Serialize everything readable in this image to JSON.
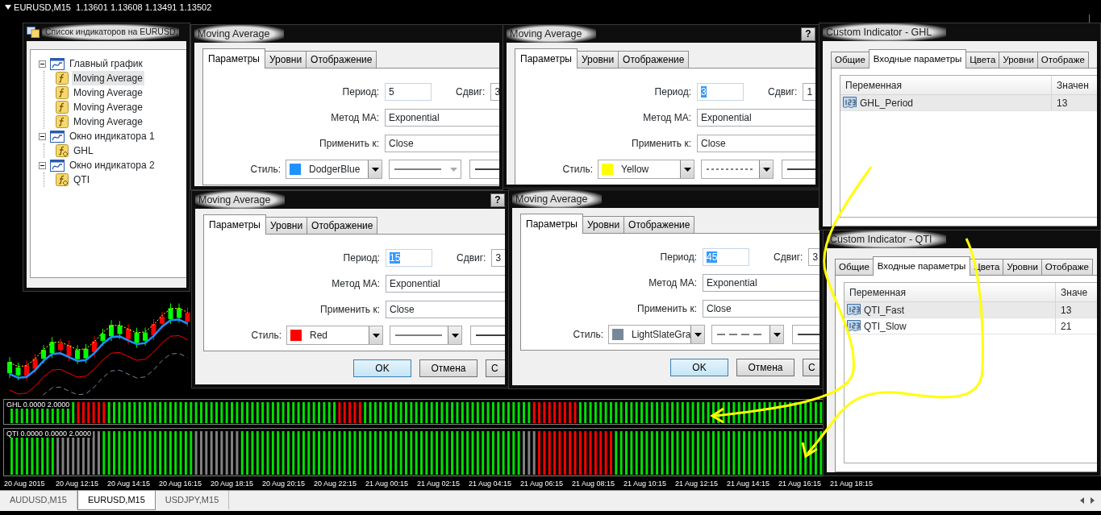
{
  "chart": {
    "header": "EURUSD,M15  1.13601 1.13608 1.13491 1.13502"
  },
  "indicator_windows": [
    {
      "label": "GHL 0.0000 2.0000"
    },
    {
      "label": "QTI 0.0000 0.0000 2.0000"
    }
  ],
  "time_axis": [
    "20 Aug 2015",
    "20 Aug 12:15",
    "20 Aug 14:15",
    "20 Aug 16:15",
    "20 Aug 18:15",
    "20 Aug 20:15",
    "20 Aug 22:15",
    "21 Aug 00:15",
    "21 Aug 02:15",
    "21 Aug 04:15",
    "21 Aug 06:15",
    "21 Aug 08:15",
    "21 Aug 10:15",
    "21 Aug 12:15",
    "21 Aug 14:15",
    "21 Aug 16:15",
    "21 Aug 18:15"
  ],
  "symbol_tabs": [
    {
      "label": "AUDUSD,M15",
      "selected": false
    },
    {
      "label": "EURUSD,M15",
      "selected": true
    },
    {
      "label": "USDJPY,M15",
      "selected": false
    }
  ],
  "indicator_list": {
    "title": "Список индикаторов на EURUSD,",
    "tree": [
      {
        "label": "Главный график",
        "kind": "window",
        "expanded": true,
        "selected": false,
        "children": [
          {
            "label": "Moving Average",
            "kind": "indicator",
            "selected": true
          },
          {
            "label": "Moving Average",
            "kind": "indicator",
            "selected": false
          },
          {
            "label": "Moving Average",
            "kind": "indicator",
            "selected": false
          },
          {
            "label": "Moving Average",
            "kind": "indicator",
            "selected": false
          }
        ]
      },
      {
        "label": "Окно индикатора 1",
        "kind": "window",
        "expanded": true,
        "selected": false,
        "children": [
          {
            "label": "GHL",
            "kind": "custom",
            "selected": false
          }
        ]
      },
      {
        "label": "Окно индикатора 2",
        "kind": "window",
        "expanded": true,
        "selected": false,
        "children": [
          {
            "label": "QTI",
            "kind": "custom",
            "selected": false
          }
        ]
      }
    ]
  },
  "ma_dialogs": [
    {
      "title": "Moving Average",
      "tabs": [
        {
          "label": "Параметры",
          "selected": true
        },
        {
          "label": "Уровни",
          "selected": false
        },
        {
          "label": "Отображение",
          "selected": false
        }
      ],
      "period_label": "Период:",
      "period": "5",
      "period_selected": false,
      "shift_label": "Сдвиг:",
      "shift": "3",
      "method_label": "Метод MA:",
      "method": "Exponential",
      "apply_label": "Применить к:",
      "apply": "Close",
      "style_label": "Стиль:",
      "color_name": "DodgerBlue",
      "color": "#1e90ff",
      "line": {
        "kind": "solid",
        "disabled": true
      }
    },
    {
      "title": "Moving Average",
      "help": "?",
      "tabs": [
        {
          "label": "Параметры",
          "selected": true
        },
        {
          "label": "Уровни",
          "selected": false
        },
        {
          "label": "Отображение",
          "selected": false
        }
      ],
      "period_label": "Период:",
      "period": "3",
      "period_selected": true,
      "shift_label": "Сдвиг:",
      "shift": "1",
      "method_label": "Метод MA:",
      "method": "Exponential",
      "apply_label": "Применить к:",
      "apply": "Close",
      "style_label": "Стиль:",
      "color_name": "Yellow",
      "color": "#ffff00",
      "line": {
        "kind": "dotted",
        "disabled": false
      }
    },
    {
      "title": "Moving Average",
      "help": "?",
      "tabs": [
        {
          "label": "Параметры",
          "selected": true
        },
        {
          "label": "Уровни",
          "selected": false
        },
        {
          "label": "Отображение",
          "selected": false
        }
      ],
      "period_label": "Период:",
      "period": "15",
      "period_selected": true,
      "shift_label": "Сдвиг:",
      "shift": "3",
      "method_label": "Метод MA:",
      "method": "Exponential",
      "apply_label": "Применить к:",
      "apply": "Close",
      "style_label": "Стиль:",
      "color_name": "Red",
      "color": "#ff0000",
      "line": {
        "kind": "solid",
        "disabled": false
      },
      "buttons": [
        {
          "label": "OK",
          "default": true
        },
        {
          "label": "Отмена",
          "default": false
        },
        {
          "label": "С",
          "default": false
        }
      ]
    },
    {
      "title": "Moving Average",
      "tabs": [
        {
          "label": "Параметры",
          "selected": true
        },
        {
          "label": "Уровни",
          "selected": false
        },
        {
          "label": "Отображение",
          "selected": false
        }
      ],
      "period_label": "Период:",
      "period": "45",
      "period_selected": true,
      "shift_label": "Сдвиг:",
      "shift": "3",
      "method_label": "Метод MA:",
      "method": "Exponential",
      "apply_label": "Применить к:",
      "apply": "Close",
      "style_label": "Стиль:",
      "color_name": "LightSlateGra",
      "color": "#778899",
      "line": {
        "kind": "dashed",
        "disabled": false
      },
      "buttons": [
        {
          "label": "OK",
          "default": true
        },
        {
          "label": "Отмена",
          "default": false
        },
        {
          "label": "С",
          "default": false
        }
      ]
    }
  ],
  "custom_dialogs": [
    {
      "title": "Custom Indicator - GHL",
      "tabs": [
        {
          "label": "Общие",
          "selected": false
        },
        {
          "label": "Входные параметры",
          "selected": true
        },
        {
          "label": "Цвета",
          "selected": false
        },
        {
          "label": "Уровни",
          "selected": false
        },
        {
          "label": "Отображе",
          "selected": false
        }
      ],
      "columns": [
        "Переменная",
        "Значен"
      ],
      "rows": [
        {
          "name": "GHL_Period",
          "value": "13",
          "selected": true
        }
      ]
    },
    {
      "title": "Custom Indicator - QTI",
      "tabs": [
        {
          "label": "Общие",
          "selected": false
        },
        {
          "label": "Входные параметры",
          "selected": true
        },
        {
          "label": "Цвета",
          "selected": false
        },
        {
          "label": "Уровни",
          "selected": false
        },
        {
          "label": "Отображе",
          "selected": false
        }
      ],
      "columns": [
        "Переменная",
        "Значе"
      ],
      "rows": [
        {
          "name": "QTI_Fast",
          "value": "13",
          "selected": true
        },
        {
          "name": "QTI_Slow",
          "value": "21",
          "selected": false
        }
      ]
    }
  ]
}
